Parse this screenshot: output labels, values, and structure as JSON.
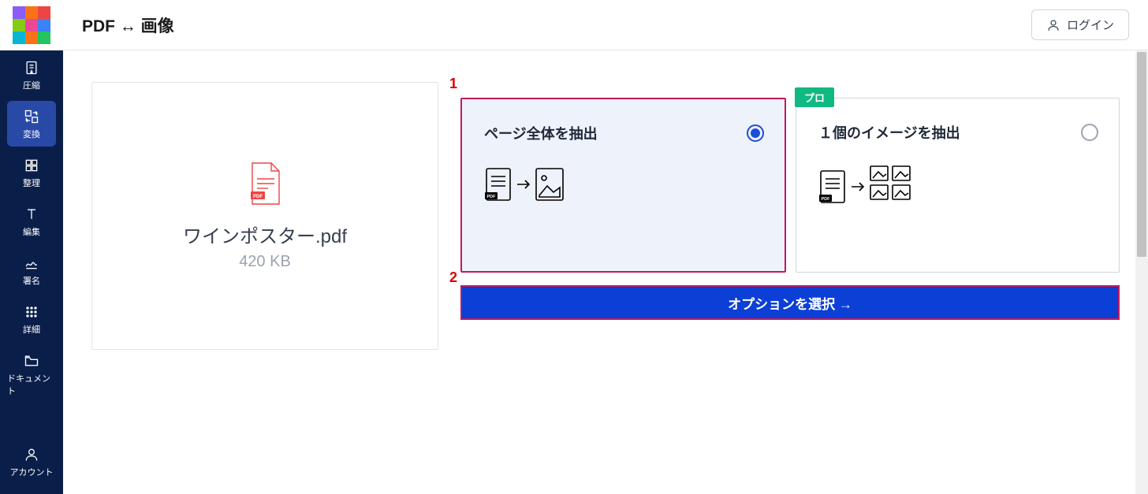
{
  "header": {
    "title": "PDF ↔ 画像",
    "login_label": "ログイン"
  },
  "sidebar": {
    "items": [
      {
        "label": "圧縮"
      },
      {
        "label": "変換"
      },
      {
        "label": "整理"
      },
      {
        "label": "編集"
      },
      {
        "label": "署名"
      },
      {
        "label": "詳細"
      },
      {
        "label": "ドキュメント"
      }
    ],
    "account_label": "アカウント"
  },
  "file": {
    "name": "ワインポスター.pdf",
    "size": "420 KB"
  },
  "options": {
    "opt1": {
      "label": "ページ全体を抽出"
    },
    "opt2": {
      "label": "１個のイメージを抽出",
      "badge": "プロ"
    }
  },
  "cta": {
    "label": "オプションを選択 →"
  },
  "annotations": {
    "a1": "1",
    "a2": "2"
  }
}
